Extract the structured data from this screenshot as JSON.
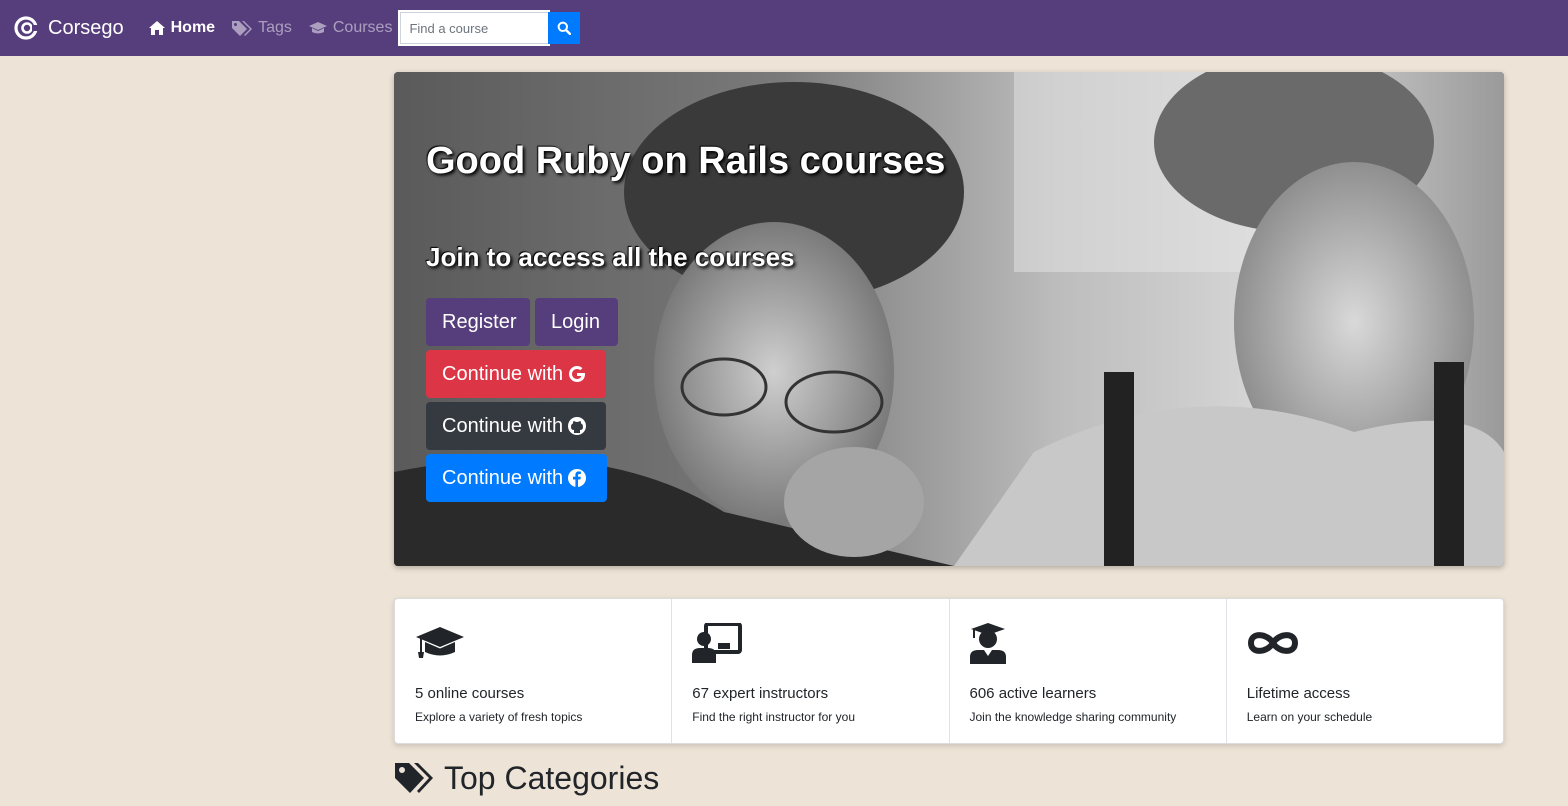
{
  "navbar": {
    "brand": "Corsego",
    "home_label": "Home",
    "tags_label": "Tags",
    "courses_label": "Courses",
    "search_placeholder": "Find a course"
  },
  "hero": {
    "title": "Good Ruby on Rails courses",
    "subtitle": "Join to access all the courses",
    "register_label": "Register",
    "login_label": "Login",
    "google_label": "Continue with",
    "github_label": "Continue with",
    "facebook_label": "Continue with"
  },
  "features": [
    {
      "icon": "graduation-cap-icon",
      "title": "5 online courses",
      "desc": "Explore a variety of fresh topics"
    },
    {
      "icon": "chalkboard-teacher-icon",
      "title": "67 expert instructors",
      "desc": "Find the right instructor for you"
    },
    {
      "icon": "user-graduate-icon",
      "title": "606 active learners",
      "desc": "Join the knowledge sharing community"
    },
    {
      "icon": "infinity-icon",
      "title": "Lifetime access",
      "desc": "Learn on your schedule"
    }
  ],
  "section": {
    "title": "Top Categories"
  },
  "colors": {
    "navbar": "#563d7c",
    "background": "#ede3d6",
    "primary": "#007bff",
    "danger": "#dc3545",
    "dark": "#343a40"
  }
}
